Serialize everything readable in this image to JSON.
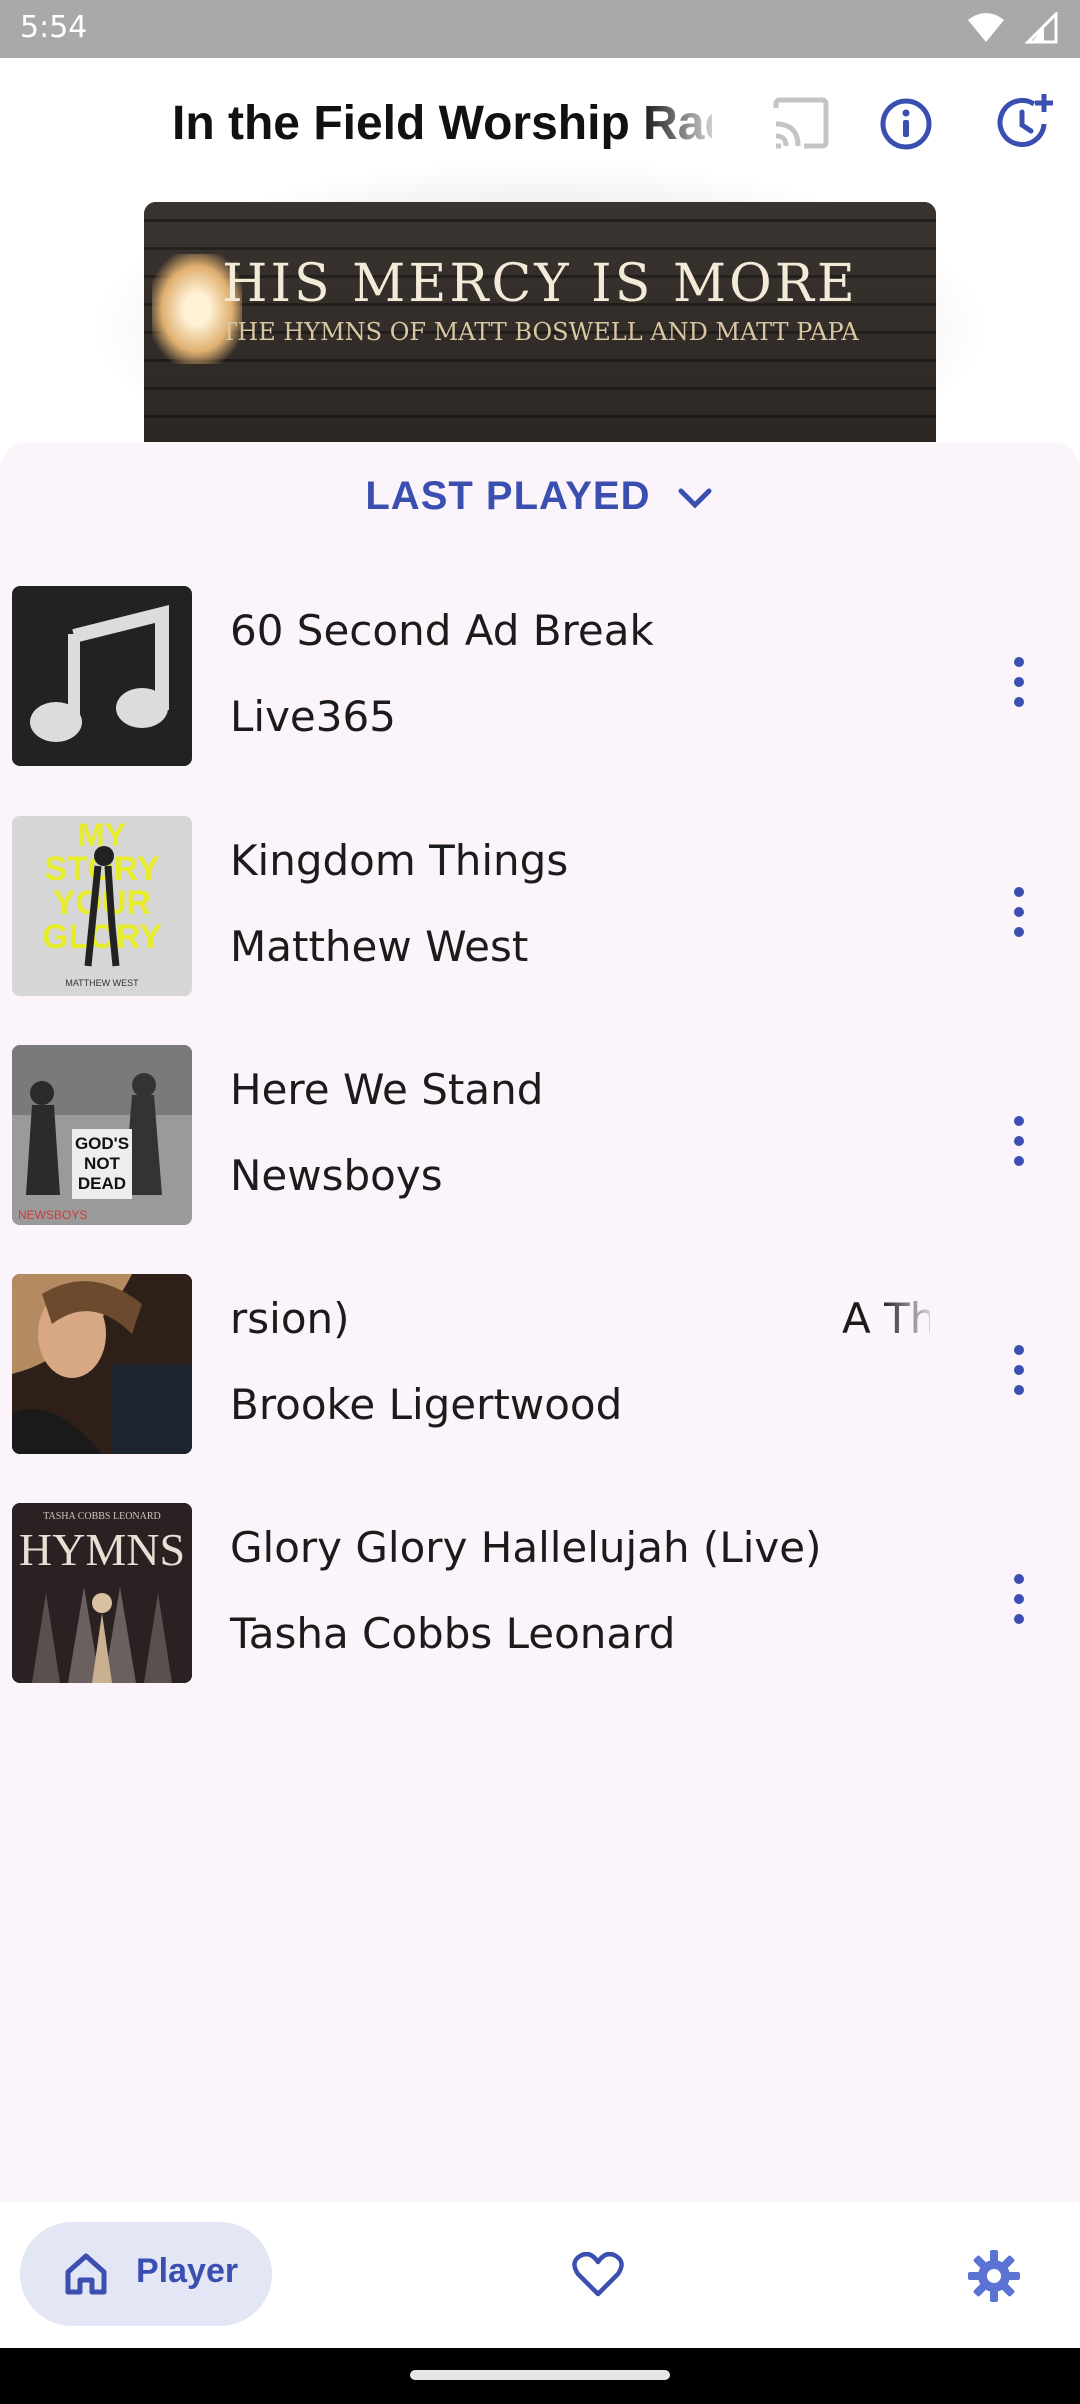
{
  "status_bar": {
    "time": "5:54"
  },
  "header": {
    "station_title": "In the Field Worship Radio"
  },
  "now_playing_art": {
    "title": "HIS MERCY IS MORE",
    "subtitle": "THE HYMNS OF MATT BOSWELL AND MATT PAPA"
  },
  "history": {
    "header_label": "LAST PLAYED",
    "tracks": [
      {
        "title": "60 Second Ad Break",
        "artist": "Live365"
      },
      {
        "title": "Kingdom Things",
        "artist": "Matthew West"
      },
      {
        "title": "Here We Stand",
        "artist": "Newsboys"
      },
      {
        "title": "rsion)",
        "title_tail": "A Th",
        "artist": "Brooke Ligertwood"
      },
      {
        "title": "Glory Glory Hallelujah (Live)",
        "artist": "Tasha Cobbs Leonard"
      }
    ]
  },
  "thumbnails": {
    "kingdom_things": [
      "MY",
      "STORY",
      "YOUR",
      "GLORY",
      "MATTHEW WEST"
    ],
    "here_we_stand": [
      "GOD'S",
      "NOT",
      "DEAD",
      "NEWSBOYS"
    ],
    "glory_glory": [
      "TASHA COBBS LEONARD",
      "HYMNS"
    ]
  },
  "bottom_nav": {
    "player_label": "Player"
  },
  "colors": {
    "accent": "#3b4fb0",
    "sheet_bg": "#fbf5fb",
    "status_bar": "#a9a9a9"
  }
}
